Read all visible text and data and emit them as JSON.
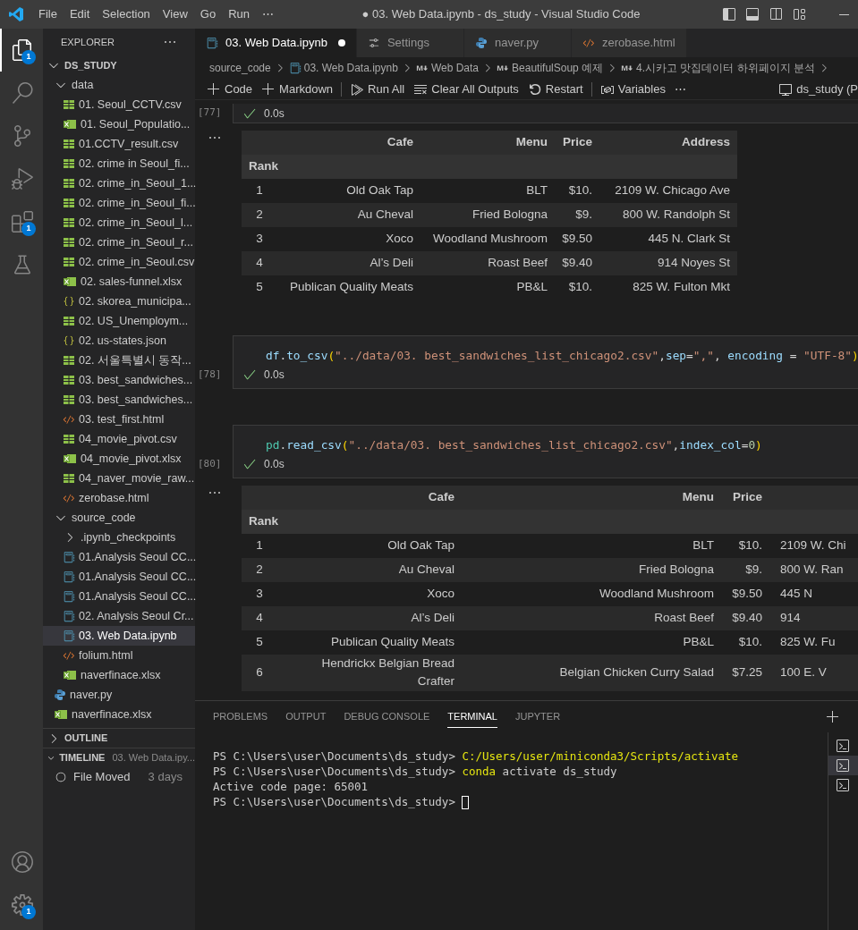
{
  "window": {
    "title": "● 03. Web Data.ipynb - ds_study - Visual Studio Code"
  },
  "menu": [
    "File",
    "Edit",
    "Selection",
    "View",
    "Go",
    "Run",
    "⋯"
  ],
  "activity_bar": [
    {
      "kind": "explorer",
      "selected": true,
      "badge": "1"
    },
    {
      "kind": "search",
      "selected": false
    },
    {
      "kind": "source-control",
      "selected": false
    },
    {
      "kind": "run-debug",
      "selected": false
    },
    {
      "kind": "extensions",
      "selected": false,
      "badge": "1"
    },
    {
      "kind": "testing",
      "selected": false
    }
  ],
  "activity_bar_bottom": [
    {
      "kind": "accounts",
      "selected": false
    },
    {
      "kind": "settings",
      "selected": false,
      "badge": "1"
    }
  ],
  "sidebar": {
    "title": "EXPLORER",
    "root": "DS_STUDY",
    "tree": [
      {
        "label": "data",
        "kind": "folder",
        "expanded": true,
        "selected": false,
        "children": [
          {
            "label": "01. Seoul_CCTV.csv",
            "kind": "csv",
            "selected": false
          },
          {
            "label": "01. Seoul_Populatio...",
            "kind": "xlsx",
            "selected": false
          },
          {
            "label": "01.CCTV_result.csv",
            "kind": "csv",
            "selected": false
          },
          {
            "label": "02. crime in Seoul_fi...",
            "kind": "csv",
            "selected": false
          },
          {
            "label": "02. crime_in_Seoul_1...",
            "kind": "csv",
            "selected": false
          },
          {
            "label": "02. crime_in_Seoul_fi...",
            "kind": "csv",
            "selected": false
          },
          {
            "label": "02. crime_in_Seoul_l...",
            "kind": "csv",
            "selected": false
          },
          {
            "label": "02. crime_in_Seoul_r...",
            "kind": "csv",
            "selected": false
          },
          {
            "label": "02. crime_in_Seoul.csv",
            "kind": "csv",
            "selected": false
          },
          {
            "label": "02. sales-funnel.xlsx",
            "kind": "xlsx",
            "selected": false
          },
          {
            "label": "02. skorea_municipa...",
            "kind": "json",
            "selected": false
          },
          {
            "label": "02. US_Unemploym...",
            "kind": "csv",
            "selected": false
          },
          {
            "label": "02. us-states.json",
            "kind": "json",
            "selected": false
          },
          {
            "label": "02. 서울특별시 동작...",
            "kind": "csv",
            "selected": false
          },
          {
            "label": "03. best_sandwiches...",
            "kind": "csv",
            "selected": false
          },
          {
            "label": "03. best_sandwiches...",
            "kind": "csv",
            "selected": false
          },
          {
            "label": "03. test_first.html",
            "kind": "html",
            "selected": false
          },
          {
            "label": "04_movie_pivot.csv",
            "kind": "csv",
            "selected": false
          },
          {
            "label": "04_movie_pivot.xlsx",
            "kind": "xlsx",
            "selected": false
          },
          {
            "label": "04_naver_movie_raw...",
            "kind": "csv",
            "selected": false
          },
          {
            "label": "zerobase.html",
            "kind": "html",
            "selected": false
          }
        ]
      },
      {
        "label": "source_code",
        "kind": "folder",
        "expanded": true,
        "selected": false,
        "children": [
          {
            "label": ".ipynb_checkpoints",
            "kind": "folder",
            "expanded": false,
            "selected": false
          },
          {
            "label": "01.Analysis Seoul CC...",
            "kind": "ipynb",
            "selected": false
          },
          {
            "label": "01.Analysis Seoul CC...",
            "kind": "ipynb",
            "selected": false
          },
          {
            "label": "01.Analysis Seoul CC...",
            "kind": "ipynb",
            "selected": false
          },
          {
            "label": "02. Analysis Seoul Cr...",
            "kind": "ipynb",
            "selected": false
          },
          {
            "label": "03. Web Data.ipynb",
            "kind": "ipynb",
            "selected": true
          },
          {
            "label": "folium.html",
            "kind": "html",
            "selected": false
          },
          {
            "label": "naverfinace.xlsx",
            "kind": "xlsx",
            "selected": false
          }
        ]
      },
      {
        "label": "naver.py",
        "kind": "py",
        "selected": false
      },
      {
        "label": "naverfinace.xlsx",
        "kind": "xlsx",
        "selected": false
      }
    ],
    "outline": {
      "title": "OUTLINE",
      "expanded": false
    },
    "timeline": {
      "title": "TIMELINE",
      "expanded": true,
      "subtitle": "03. Web Data.ipy...",
      "entries": [
        {
          "label": "File Moved",
          "time": "3 days"
        }
      ]
    }
  },
  "tabs": [
    {
      "label": "03. Web Data.ipynb",
      "kind": "ipynb",
      "selected": true,
      "dirty": true
    },
    {
      "label": "Settings",
      "kind": "settings",
      "selected": false,
      "dirty": false
    },
    {
      "label": "naver.py",
      "kind": "py",
      "selected": false,
      "dirty": false
    },
    {
      "label": "zerobase.html",
      "kind": "html",
      "selected": false,
      "dirty": false
    }
  ],
  "breadcrumbs": [
    {
      "label": "source_code",
      "kind": "folder"
    },
    {
      "label": "03. Web Data.ipynb",
      "kind": "ipynb"
    },
    {
      "label": "Web Data",
      "kind": "markdown"
    },
    {
      "label": "BeautifulSoup 예제",
      "kind": "markdown"
    },
    {
      "label": "4.시카고 맛집데이터 하위페이지 분석",
      "kind": "markdown"
    }
  ],
  "toolbar": [
    {
      "label": "Code",
      "kind": "add"
    },
    {
      "label": "Markdown",
      "kind": "add"
    },
    {
      "label": "Run All",
      "kind": "run-all"
    },
    {
      "label": "Clear All Outputs",
      "kind": "clear"
    },
    {
      "label": "Restart",
      "kind": "restart"
    },
    {
      "label": "Variables",
      "kind": "variables"
    },
    {
      "label": "⋯",
      "kind": "more"
    }
  ],
  "kernel": "ds_study (P",
  "cells": [
    {
      "exec": "[77]",
      "status": "0.0s",
      "success": true,
      "output": {
        "columns": [
          "",
          "Cafe",
          "Menu",
          "Price",
          "Address"
        ],
        "index_name": "Rank",
        "rows": [
          [
            "1",
            "Old Oak Tap",
            "BLT",
            "$10.",
            "2109 W. Chicago Ave"
          ],
          [
            "2",
            "Au Cheval",
            "Fried Bologna",
            "$9.",
            "800 W. Randolph St"
          ],
          [
            "3",
            "Xoco",
            "Woodland Mushroom",
            "$9.50",
            "445 N. Clark St"
          ],
          [
            "4",
            "Al’s Deli",
            "Roast Beef",
            "$9.40",
            "914 Noyes St"
          ],
          [
            "5",
            "Publican Quality Meats",
            "PB&L",
            "$10.",
            "825 W. Fulton Mkt"
          ]
        ]
      }
    },
    {
      "exec": "[78]",
      "status": "0.0s",
      "success": true,
      "code": [
        {
          "text": "df",
          "kind": "var"
        },
        {
          "text": ".",
          "kind": "punct"
        },
        {
          "text": "to_csv",
          "kind": "var"
        },
        {
          "text": "(",
          "kind": "bracket"
        },
        {
          "text": "\"../data/03. best_sandwiches_list_chicago2.csv\"",
          "kind": "str"
        },
        {
          "text": ",",
          "kind": "punct"
        },
        {
          "text": "sep",
          "kind": "param"
        },
        {
          "text": "=",
          "kind": "punct"
        },
        {
          "text": "\",\"",
          "kind": "str"
        },
        {
          "text": ", ",
          "kind": "punct"
        },
        {
          "text": "encoding",
          "kind": "param"
        },
        {
          "text": " = ",
          "kind": "punct"
        },
        {
          "text": "\"UTF-8\"",
          "kind": "str"
        },
        {
          "text": ")",
          "kind": "bracket"
        }
      ]
    },
    {
      "exec": "[80]",
      "status": "0.0s",
      "success": true,
      "code": [
        {
          "text": "pd",
          "kind": "module"
        },
        {
          "text": ".",
          "kind": "punct"
        },
        {
          "text": "read_csv",
          "kind": "var"
        },
        {
          "text": "(",
          "kind": "bracket"
        },
        {
          "text": "\"../data/03. best_sandwiches_list_chicago2.csv\"",
          "kind": "str"
        },
        {
          "text": ",",
          "kind": "punct"
        },
        {
          "text": "index_col",
          "kind": "param"
        },
        {
          "text": "=",
          "kind": "punct"
        },
        {
          "text": "0",
          "kind": "num"
        },
        {
          "text": ")",
          "kind": "bracket"
        }
      ],
      "output": {
        "columns": [
          "",
          "Cafe",
          "Menu",
          "Price"
        ],
        "index_name": "Rank",
        "rows": [
          [
            "1",
            "Old Oak Tap",
            "BLT",
            "$10.",
            "2109 W. Chi"
          ],
          [
            "2",
            "Au Cheval",
            "Fried Bologna",
            "$9.",
            "800 W. Ran"
          ],
          [
            "3",
            "Xoco",
            "Woodland Mushroom",
            "$9.50",
            "445 N"
          ],
          [
            "4",
            "Al’s Deli",
            "Roast Beef",
            "$9.40",
            "914"
          ],
          [
            "5",
            "Publican Quality Meats",
            "PB&L",
            "$10.",
            "825 W. Fu"
          ],
          [
            "6",
            "Hendrickx Belgian Bread Crafter",
            "Belgian Chicken Curry Salad",
            "$7.25",
            "100 E. V"
          ]
        ]
      }
    }
  ],
  "panel": {
    "tabs": [
      {
        "label": "PROBLEMS",
        "selected": false
      },
      {
        "label": "OUTPUT",
        "selected": false
      },
      {
        "label": "DEBUG CONSOLE",
        "selected": false
      },
      {
        "label": "TERMINAL",
        "selected": true
      },
      {
        "label": "JUPYTER",
        "selected": false
      }
    ],
    "terminal": [
      [
        {
          "text": "PS C:\\Users\\user\\Documents\\ds_study> ",
          "kind": "plain"
        },
        {
          "text": "C:/Users/user/miniconda3/Scripts/activate",
          "kind": "command"
        }
      ],
      [
        {
          "text": "PS C:\\Users\\user\\Documents\\ds_study> ",
          "kind": "plain"
        },
        {
          "text": "conda",
          "kind": "command"
        },
        {
          "text": " activate ds_study",
          "kind": "plain"
        }
      ],
      [
        {
          "text": "Active code page: 65001",
          "kind": "plain"
        }
      ],
      [
        {
          "text": "PS C:\\Users\\user\\Documents\\ds_study> ",
          "kind": "plain"
        },
        {
          "kind": "cursor"
        }
      ]
    ],
    "instances": [
      {
        "selected": false
      },
      {
        "selected": true
      },
      {
        "selected": false
      }
    ]
  }
}
